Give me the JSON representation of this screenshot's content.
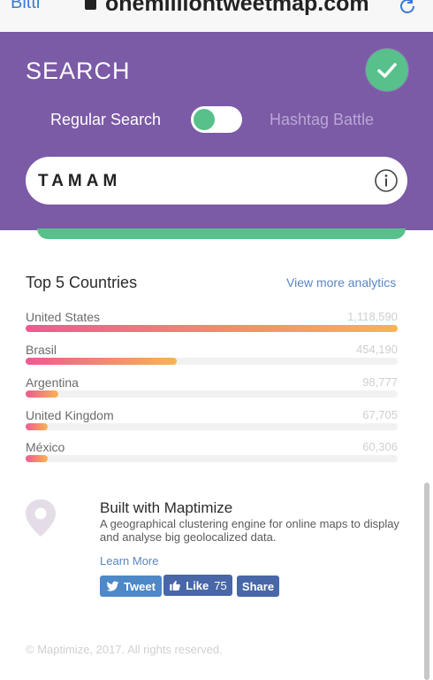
{
  "browser": {
    "done_label": "Bitti",
    "url": "onemilliontweetmap.com"
  },
  "search": {
    "title": "SEARCH",
    "mode_regular": "Regular Search",
    "mode_hashtag": "Hashtag Battle",
    "query_value": "TAMAM",
    "query_placeholder": ""
  },
  "countries": {
    "title": "Top 5 Countries",
    "view_more_label": "View more analytics",
    "items": [
      {
        "name": "United States",
        "value": "1,118,590",
        "count": 1118590
      },
      {
        "name": "Brasil",
        "value": "454,190",
        "count": 454190
      },
      {
        "name": "Argentina",
        "value": "98,777",
        "count": 98777
      },
      {
        "name": "United Kingdom",
        "value": "67,705",
        "count": 67705
      },
      {
        "name": "México",
        "value": "60,306",
        "count": 60306
      }
    ]
  },
  "maptimize": {
    "title": "Built with Maptimize",
    "description": "A geographical clustering engine for online maps to display and analyse big geolocalized data.",
    "learn_more_label": "Learn More"
  },
  "social": {
    "tweet_label": "Tweet",
    "like_label": "Like",
    "like_count": "75",
    "share_label": "Share"
  },
  "footer": {
    "copyright": "© Maptimize, 2017. All rights reserved."
  },
  "colors": {
    "panel": "#7b5aa6",
    "accent_green": "#57c08b",
    "bar_start": "#ee5a92",
    "bar_end": "#f7b453",
    "link": "#5a86c4"
  }
}
